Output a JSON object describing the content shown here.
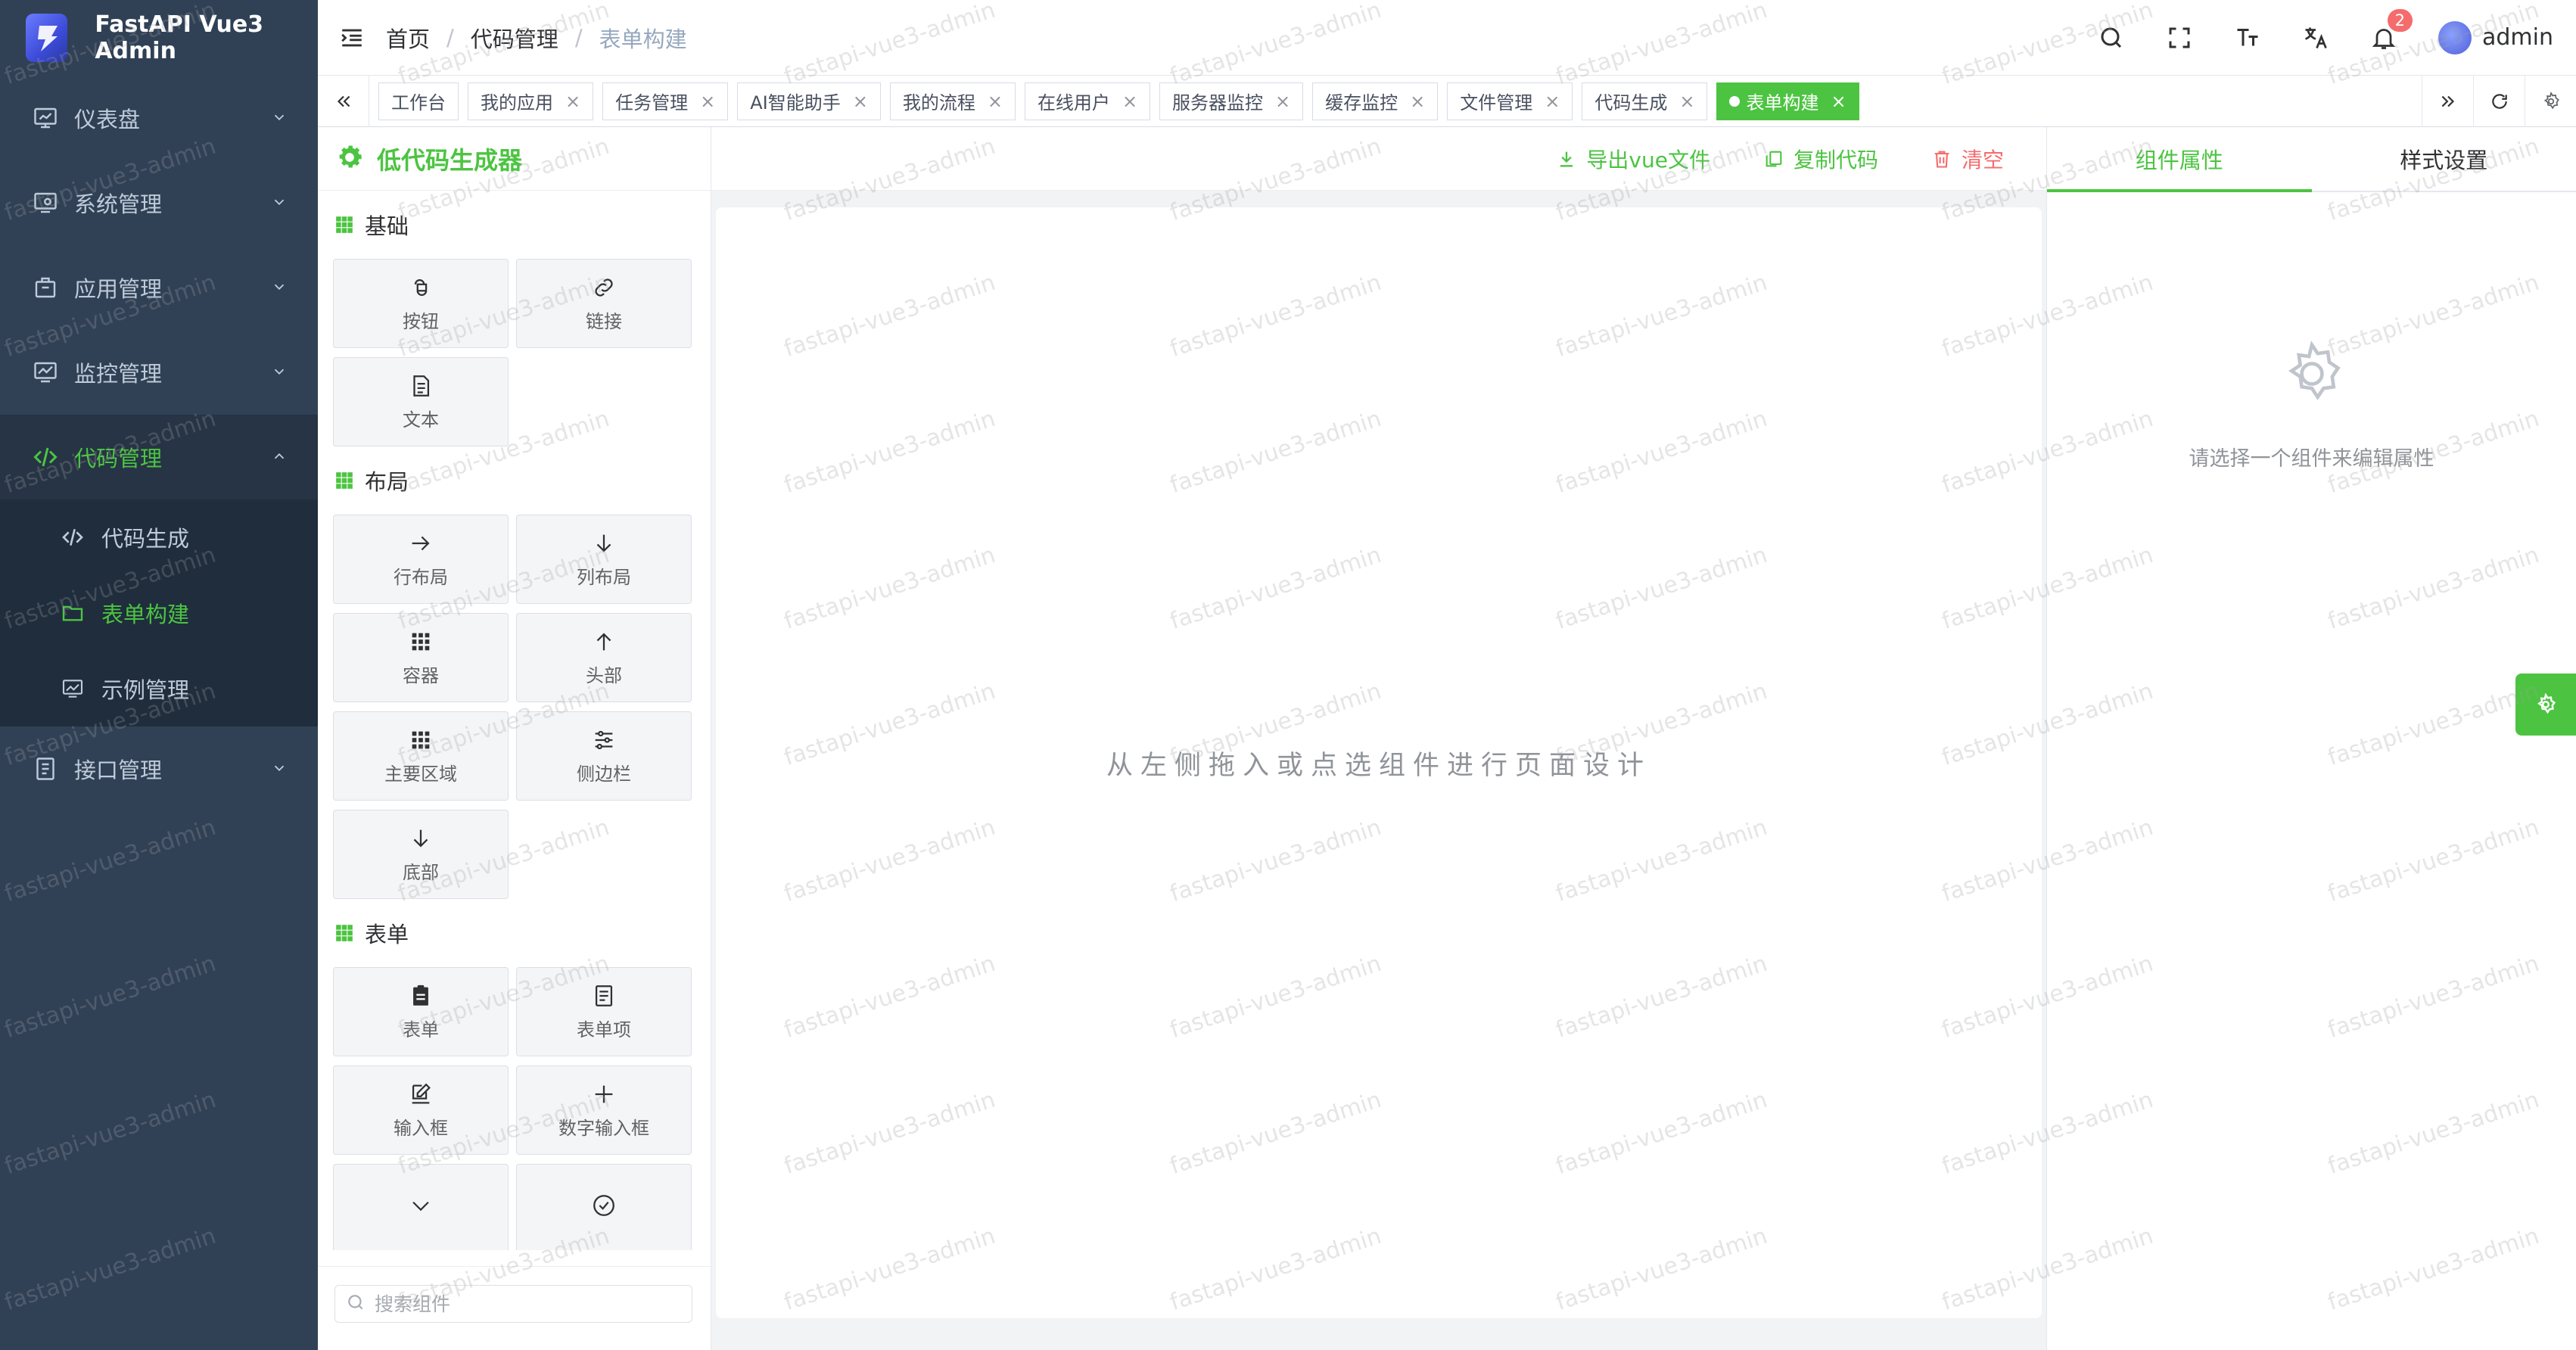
{
  "app": {
    "title": "FastAPI Vue3 Admin"
  },
  "sidebar": {
    "items": [
      {
        "label": "仪表盘",
        "icon": "dashboard-icon"
      },
      {
        "label": "系统管理",
        "icon": "system-icon"
      },
      {
        "label": "应用管理",
        "icon": "app-icon"
      },
      {
        "label": "监控管理",
        "icon": "monitor-icon"
      },
      {
        "label": "代码管理",
        "icon": "code-icon",
        "expanded": true
      },
      {
        "label": "接口管理",
        "icon": "api-icon"
      }
    ],
    "code_sub": [
      {
        "label": "代码生成",
        "icon": "code-icon"
      },
      {
        "label": "表单构建",
        "icon": "folder-icon",
        "active": true
      },
      {
        "label": "示例管理",
        "icon": "chart-icon"
      }
    ]
  },
  "header": {
    "breadcrumb": [
      "首页",
      "代码管理",
      "表单构建"
    ],
    "separator": "/",
    "badge_count": "2",
    "username": "admin"
  },
  "tags": [
    {
      "label": "工作台",
      "closable": false
    },
    {
      "label": "我的应用",
      "closable": true
    },
    {
      "label": "任务管理",
      "closable": true
    },
    {
      "label": "AI智能助手",
      "closable": true
    },
    {
      "label": "我的流程",
      "closable": true
    },
    {
      "label": "在线用户",
      "closable": true
    },
    {
      "label": "服务器监控",
      "closable": true
    },
    {
      "label": "缓存监控",
      "closable": true
    },
    {
      "label": "文件管理",
      "closable": true
    },
    {
      "label": "代码生成",
      "closable": true
    },
    {
      "label": "表单构建",
      "closable": true,
      "active": true
    }
  ],
  "close_glyph": "×",
  "components": {
    "title": "低代码生成器",
    "groups": [
      {
        "title": "基础",
        "items": [
          {
            "label": "按钮",
            "icon": "button-icon"
          },
          {
            "label": "链接",
            "icon": "link-icon"
          },
          {
            "label": "文本",
            "icon": "text-icon"
          }
        ]
      },
      {
        "title": "布局",
        "items": [
          {
            "label": "行布局",
            "icon": "arrow-right-icon"
          },
          {
            "label": "列布局",
            "icon": "arrow-down-icon"
          },
          {
            "label": "容器",
            "icon": "grid-icon"
          },
          {
            "label": "头部",
            "icon": "arrow-up-icon"
          },
          {
            "label": "主要区域",
            "icon": "grid-icon"
          },
          {
            "label": "侧边栏",
            "icon": "sliders-icon"
          },
          {
            "label": "底部",
            "icon": "arrow-down-icon"
          }
        ]
      },
      {
        "title": "表单",
        "items": [
          {
            "label": "表单",
            "icon": "form-icon"
          },
          {
            "label": "表单项",
            "icon": "form-item-icon"
          },
          {
            "label": "输入框",
            "icon": "edit-icon"
          },
          {
            "label": "数字输入框",
            "icon": "plus-icon"
          },
          {
            "label": "",
            "icon": "chevron-down-icon"
          },
          {
            "label": "",
            "icon": "check-circle-icon"
          }
        ]
      }
    ],
    "search_placeholder": "搜索组件"
  },
  "toolbar": {
    "export_label": "导出vue文件",
    "copy_label": "复制代码",
    "clear_label": "清空"
  },
  "canvas": {
    "hint": "从左侧拖入或点选组件进行页面设计"
  },
  "properties": {
    "tabs": [
      "组件属性",
      "样式设置"
    ],
    "empty_text": "请选择一个组件来编辑属性"
  },
  "watermark": "fastapi-vue3-admin",
  "colors": {
    "accent": "#4cc441",
    "sidebar": "#304156",
    "danger": "#f56c6c"
  }
}
